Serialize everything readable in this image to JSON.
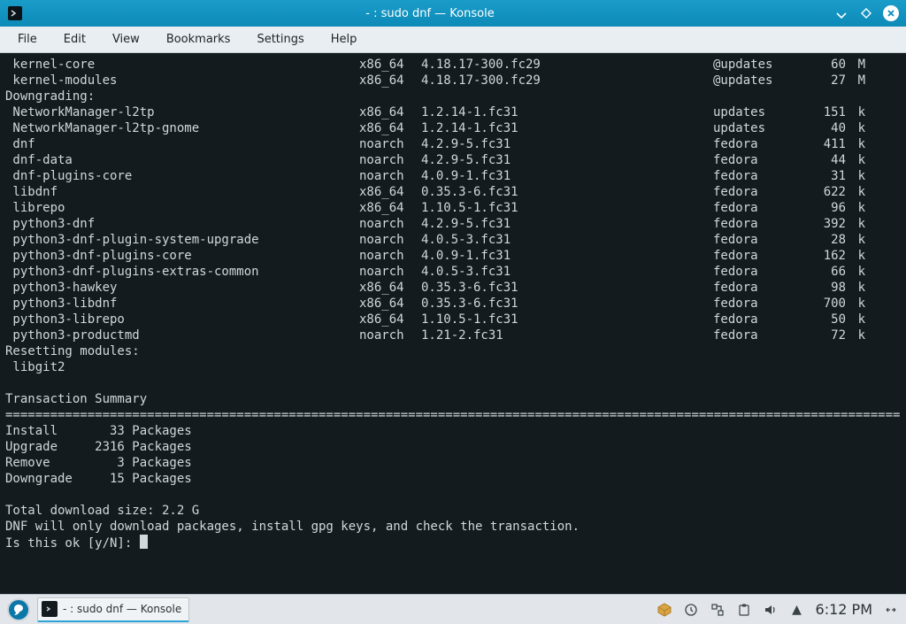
{
  "window": {
    "title": "- : sudo dnf — Konsole"
  },
  "menubar": {
    "items": [
      "File",
      "Edit",
      "View",
      "Bookmarks",
      "Settings",
      "Help"
    ]
  },
  "terminal": {
    "rows": [
      {
        "pkg": " kernel-core",
        "arch": "x86_64",
        "ver": "4.18.17-300.fc29",
        "repo": "@updates",
        "size": "60",
        "unit": "M"
      },
      {
        "pkg": " kernel-modules",
        "arch": "x86_64",
        "ver": "4.18.17-300.fc29",
        "repo": "@updates",
        "size": "27",
        "unit": "M"
      }
    ],
    "downgrading_label": "Downgrading:",
    "downgrading": [
      {
        "pkg": " NetworkManager-l2tp",
        "arch": "x86_64",
        "ver": "1.2.14-1.fc31",
        "repo": "updates",
        "size": "151",
        "unit": "k"
      },
      {
        "pkg": " NetworkManager-l2tp-gnome",
        "arch": "x86_64",
        "ver": "1.2.14-1.fc31",
        "repo": "updates",
        "size": "40",
        "unit": "k"
      },
      {
        "pkg": " dnf",
        "arch": "noarch",
        "ver": "4.2.9-5.fc31",
        "repo": "fedora",
        "size": "411",
        "unit": "k"
      },
      {
        "pkg": " dnf-data",
        "arch": "noarch",
        "ver": "4.2.9-5.fc31",
        "repo": "fedora",
        "size": "44",
        "unit": "k"
      },
      {
        "pkg": " dnf-plugins-core",
        "arch": "noarch",
        "ver": "4.0.9-1.fc31",
        "repo": "fedora",
        "size": "31",
        "unit": "k"
      },
      {
        "pkg": " libdnf",
        "arch": "x86_64",
        "ver": "0.35.3-6.fc31",
        "repo": "fedora",
        "size": "622",
        "unit": "k"
      },
      {
        "pkg": " librepo",
        "arch": "x86_64",
        "ver": "1.10.5-1.fc31",
        "repo": "fedora",
        "size": "96",
        "unit": "k"
      },
      {
        "pkg": " python3-dnf",
        "arch": "noarch",
        "ver": "4.2.9-5.fc31",
        "repo": "fedora",
        "size": "392",
        "unit": "k"
      },
      {
        "pkg": " python3-dnf-plugin-system-upgrade",
        "arch": "noarch",
        "ver": "4.0.5-3.fc31",
        "repo": "fedora",
        "size": "28",
        "unit": "k"
      },
      {
        "pkg": " python3-dnf-plugins-core",
        "arch": "noarch",
        "ver": "4.0.9-1.fc31",
        "repo": "fedora",
        "size": "162",
        "unit": "k"
      },
      {
        "pkg": " python3-dnf-plugins-extras-common",
        "arch": "noarch",
        "ver": "4.0.5-3.fc31",
        "repo": "fedora",
        "size": "66",
        "unit": "k"
      },
      {
        "pkg": " python3-hawkey",
        "arch": "x86_64",
        "ver": "0.35.3-6.fc31",
        "repo": "fedora",
        "size": "98",
        "unit": "k"
      },
      {
        "pkg": " python3-libdnf",
        "arch": "x86_64",
        "ver": "0.35.3-6.fc31",
        "repo": "fedora",
        "size": "700",
        "unit": "k"
      },
      {
        "pkg": " python3-librepo",
        "arch": "x86_64",
        "ver": "1.10.5-1.fc31",
        "repo": "fedora",
        "size": "50",
        "unit": "k"
      },
      {
        "pkg": " python3-productmd",
        "arch": "noarch",
        "ver": "1.21-2.fc31",
        "repo": "fedora",
        "size": "72",
        "unit": "k"
      }
    ],
    "resetting_label": "Resetting modules:",
    "resetting_module": " libgit2",
    "summary_title": "Transaction Summary",
    "summary_rule": "==========================================================================================================================",
    "summary_rows": [
      {
        "label": "Install",
        "count": "33",
        "unit": "Packages"
      },
      {
        "label": "Upgrade",
        "count": "2316",
        "unit": "Packages"
      },
      {
        "label": "Remove",
        "count": "3",
        "unit": "Packages"
      },
      {
        "label": "Downgrade",
        "count": "15",
        "unit": "Packages"
      }
    ],
    "total_size_line": "Total download size: 2.2 G",
    "dl_notice": "DNF will only download packages, install gpg keys, and check the transaction.",
    "prompt": "Is this ok [y/N]: "
  },
  "taskbar": {
    "app_label": "- : sudo dnf — Konsole",
    "clock": "6:12 PM"
  }
}
